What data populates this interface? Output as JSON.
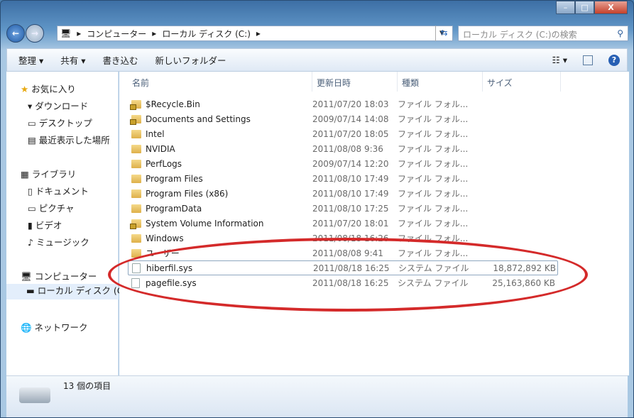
{
  "window": {
    "min": "–",
    "max": "□",
    "close": "X"
  },
  "nav": {
    "back": "←",
    "forward": "→",
    "breadcrumb": [
      "コンピューター",
      "ローカル ディスク (C:)"
    ],
    "search_placeholder": "ローカル ディスク (C:)の検索"
  },
  "toolbar": {
    "organize": "整理 ▾",
    "share": "共有 ▾",
    "burn": "書き込む",
    "new_folder": "新しいフォルダー",
    "view": "☷ ▾",
    "help": "?"
  },
  "sidebar": {
    "favorites": "お気に入り",
    "fav_items": [
      "ダウンロード",
      "デスクトップ",
      "最近表示した場所"
    ],
    "libraries": "ライブラリ",
    "lib_items": [
      "ドキュメント",
      "ピクチャ",
      "ビデオ",
      "ミュージック"
    ],
    "computer": "コンピューター",
    "computer_items": [
      "ローカル ディスク (C:)"
    ],
    "network": "ネットワーク"
  },
  "columns": [
    "名前",
    "更新日時",
    "種類",
    "サイズ"
  ],
  "files": [
    {
      "name": "$Recycle.Bin",
      "date": "2011/07/20 18:03",
      "type": "ファイル フォル...",
      "size": "",
      "icon": "lock"
    },
    {
      "name": "Documents and Settings",
      "date": "2009/07/14 14:08",
      "type": "ファイル フォル...",
      "size": "",
      "icon": "lock"
    },
    {
      "name": "Intel",
      "date": "2011/07/20 18:05",
      "type": "ファイル フォル...",
      "size": "",
      "icon": "folder"
    },
    {
      "name": "NVIDIA",
      "date": "2011/08/08 9:36",
      "type": "ファイル フォル...",
      "size": "",
      "icon": "folder"
    },
    {
      "name": "PerfLogs",
      "date": "2009/07/14 12:20",
      "type": "ファイル フォル...",
      "size": "",
      "icon": "folder"
    },
    {
      "name": "Program Files",
      "date": "2011/08/10 17:49",
      "type": "ファイル フォル...",
      "size": "",
      "icon": "folder"
    },
    {
      "name": "Program Files (x86)",
      "date": "2011/08/10 17:49",
      "type": "ファイル フォル...",
      "size": "",
      "icon": "folder"
    },
    {
      "name": "ProgramData",
      "date": "2011/08/10 17:25",
      "type": "ファイル フォル...",
      "size": "",
      "icon": "folder"
    },
    {
      "name": "System Volume Information",
      "date": "2011/07/20 18:01",
      "type": "ファイル フォル...",
      "size": "",
      "icon": "lock"
    },
    {
      "name": "Windows",
      "date": "2011/08/18 16:26",
      "type": "ファイル フォル...",
      "size": "",
      "icon": "folder"
    },
    {
      "name": "ユーザー",
      "date": "2011/08/08 9:41",
      "type": "ファイル フォル...",
      "size": "",
      "icon": "folder"
    },
    {
      "name": "hiberfil.sys",
      "date": "2011/08/18 16:25",
      "type": "システム ファイル",
      "size": "18,872,892 KB",
      "icon": "file"
    },
    {
      "name": "pagefile.sys",
      "date": "2011/08/18 16:25",
      "type": "システム ファイル",
      "size": "25,163,860 KB",
      "icon": "file"
    }
  ],
  "status": "13 個の項目",
  "colors": {
    "annotation": "#d42a2a"
  }
}
